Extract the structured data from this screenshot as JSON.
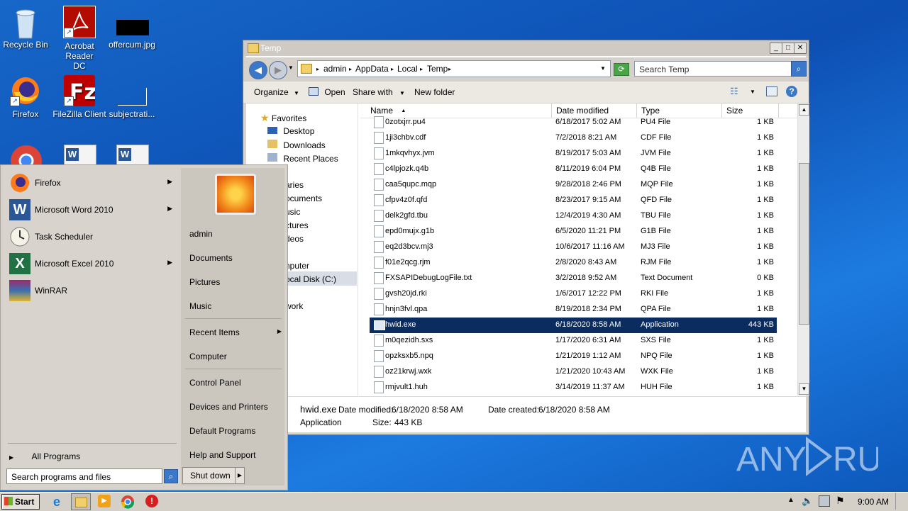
{
  "desktop": {
    "icons": [
      {
        "label": "Recycle Bin"
      },
      {
        "label": "Acrobat Reader DC"
      },
      {
        "label": "offercum.jpg"
      },
      {
        "label": "Firefox"
      },
      {
        "label": "FileZilla Client"
      },
      {
        "label": "subjectrati..."
      }
    ],
    "watermark": "ANY  RUN"
  },
  "explorer": {
    "title": "Temp",
    "breadcrumbs": [
      "admin",
      "AppData",
      "Local",
      "Temp"
    ],
    "search_placeholder": "Search Temp",
    "toolbar": {
      "organize": "Organize",
      "open": "Open",
      "share_with": "Share with",
      "new_folder": "New folder"
    },
    "nav": {
      "favorites": "Favorites",
      "desktop": "Desktop",
      "downloads": "Downloads",
      "recent_places": "Recent Places",
      "libraries": "aries",
      "documents": "ocuments",
      "music": "usic",
      "pictures": "ctures",
      "videos": "deos",
      "computer": "nputer",
      "local_disk": "ocal Disk (C:)",
      "network": "work"
    },
    "columns": {
      "name": "Name",
      "date": "Date modified",
      "type": "Type",
      "size": "Size"
    },
    "files": [
      {
        "name": "0zotxjrr.pu4",
        "date": "6/18/2017 5:02 AM",
        "type": "PU4 File",
        "size": "1 KB"
      },
      {
        "name": "1ji3chbv.cdf",
        "date": "7/2/2018 8:21 AM",
        "type": "CDF File",
        "size": "1 KB"
      },
      {
        "name": "1mkqvhyx.jvm",
        "date": "8/19/2017 5:03 AM",
        "type": "JVM File",
        "size": "1 KB"
      },
      {
        "name": "c4lpjozk.q4b",
        "date": "8/11/2019 6:04 PM",
        "type": "Q4B File",
        "size": "1 KB"
      },
      {
        "name": "caa5qupc.mqp",
        "date": "9/28/2018 2:46 PM",
        "type": "MQP File",
        "size": "1 KB"
      },
      {
        "name": "cfpv4z0f.qfd",
        "date": "8/23/2017 9:15 AM",
        "type": "QFD File",
        "size": "1 KB"
      },
      {
        "name": "delk2gfd.tbu",
        "date": "12/4/2019 4:30 AM",
        "type": "TBU File",
        "size": "1 KB"
      },
      {
        "name": "epd0mujx.g1b",
        "date": "6/5/2020 11:21 PM",
        "type": "G1B File",
        "size": "1 KB"
      },
      {
        "name": "eq2d3bcv.mj3",
        "date": "10/6/2017 11:16 AM",
        "type": "MJ3 File",
        "size": "1 KB"
      },
      {
        "name": "f01e2qcg.rjm",
        "date": "2/8/2020 8:43 AM",
        "type": "RJM File",
        "size": "1 KB"
      },
      {
        "name": "FXSAPIDebugLogFile.txt",
        "date": "3/2/2018 9:52 AM",
        "type": "Text Document",
        "size": "0 KB"
      },
      {
        "name": "gvsh20jd.rki",
        "date": "1/6/2017 12:22 PM",
        "type": "RKI File",
        "size": "1 KB"
      },
      {
        "name": "hnjn3fvl.qpa",
        "date": "8/19/2018 2:34 PM",
        "type": "QPA File",
        "size": "1 KB"
      },
      {
        "name": "hwid.exe",
        "date": "6/18/2020 8:58 AM",
        "type": "Application",
        "size": "443 KB"
      },
      {
        "name": "m0qezidh.sxs",
        "date": "1/17/2020 6:31 AM",
        "type": "SXS File",
        "size": "1 KB"
      },
      {
        "name": "opzksxb5.npq",
        "date": "1/21/2019 1:12 AM",
        "type": "NPQ File",
        "size": "1 KB"
      },
      {
        "name": "oz21krwj.wxk",
        "date": "1/21/2020 10:43 AM",
        "type": "WXK File",
        "size": "1 KB"
      },
      {
        "name": "rmjvult1.huh",
        "date": "3/14/2019 11:37 AM",
        "type": "HUH File",
        "size": "1 KB"
      }
    ],
    "selected_index": 13,
    "details": {
      "name": "hwid.exe",
      "date_modified_label": "Date modified:",
      "date_modified": "6/18/2020 8:58 AM",
      "date_created_label": "Date created:",
      "date_created": "6/18/2020 8:58 AM",
      "type": "Application",
      "size_label": "Size:",
      "size": "443 KB"
    }
  },
  "start_menu": {
    "programs": [
      {
        "label": "Firefox",
        "has_arrow": true
      },
      {
        "label": "Microsoft Word 2010",
        "has_arrow": true
      },
      {
        "label": "Task Scheduler",
        "has_arrow": false
      },
      {
        "label": "Microsoft Excel 2010",
        "has_arrow": true
      },
      {
        "label": "WinRAR",
        "has_arrow": false
      }
    ],
    "all_programs": "All Programs",
    "search_placeholder": "Search programs and files",
    "right_links": [
      "admin",
      "Documents",
      "Pictures",
      "Music",
      "Recent Items",
      "Computer",
      "Control Panel",
      "Devices and Printers",
      "Default Programs",
      "Help and Support"
    ],
    "shutdown": "Shut down"
  },
  "taskbar": {
    "start": "Start",
    "clock": "9:00 AM"
  }
}
